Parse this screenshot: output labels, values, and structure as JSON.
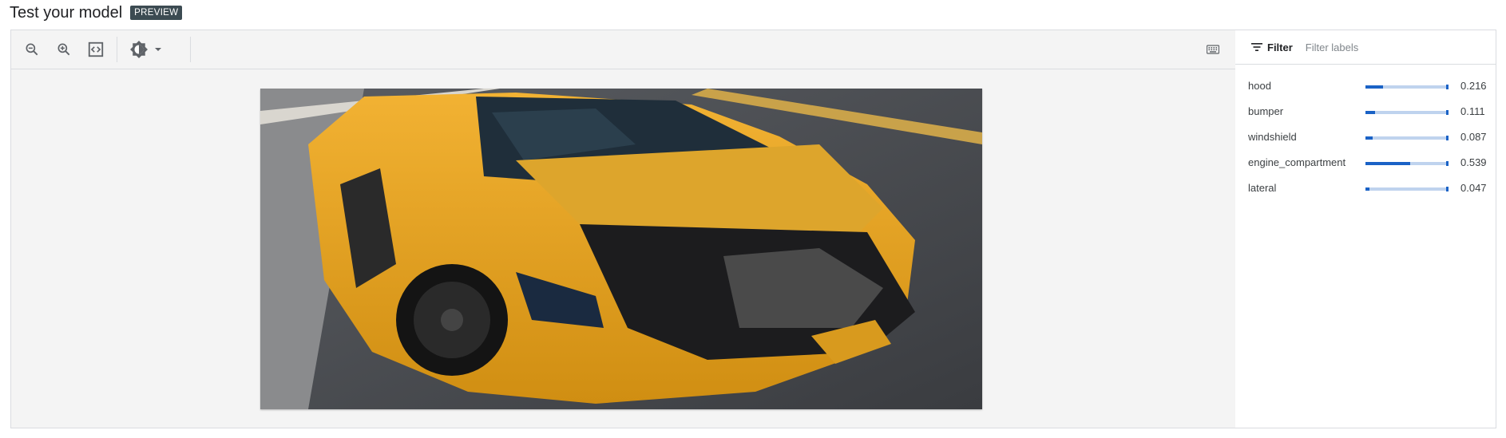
{
  "header": {
    "title": "Test your model",
    "badge": "PREVIEW"
  },
  "toolbar": {
    "buttons": [
      {
        "icon": "zoom-out-icon"
      },
      {
        "icon": "zoom-in-icon"
      },
      {
        "icon": "fit-to-screen-icon"
      },
      {
        "icon": "brightness-contrast-icon"
      },
      {
        "icon": "keyboard-icon"
      }
    ]
  },
  "panel": {
    "filter_label": "Filter",
    "filter_placeholder": "Filter labels",
    "labels": [
      {
        "name": "hood",
        "score": "0.216",
        "value": 0.216
      },
      {
        "name": "bumper",
        "score": "0.111",
        "value": 0.111
      },
      {
        "name": "windshield",
        "score": "0.087",
        "value": 0.087
      },
      {
        "name": "engine_compartment",
        "score": "0.539",
        "value": 0.539
      },
      {
        "name": "lateral",
        "score": "0.047",
        "value": 0.047
      }
    ]
  },
  "colors": {
    "accent": "#1a62c6",
    "track": "#bfd3ee",
    "badge": "#3c4b52"
  }
}
